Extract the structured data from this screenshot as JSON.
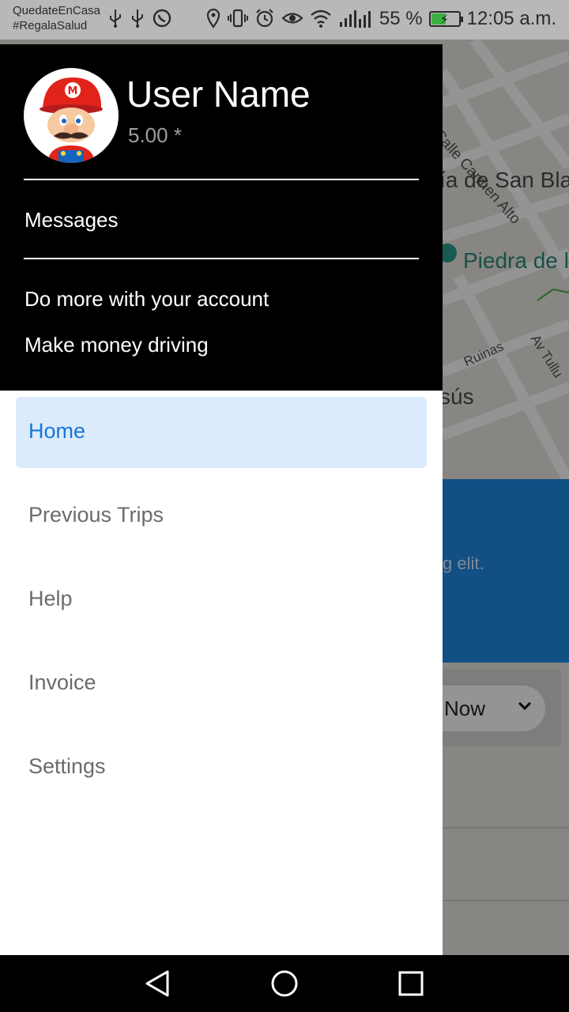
{
  "status_bar": {
    "carrier_line1": "QuedateEnCasa",
    "carrier_line2": "#RegalaSalud",
    "battery_percent": "55 %",
    "battery_level": 0.55,
    "time": "12:05 a.m.",
    "icons": [
      "usb-icon",
      "usb-icon",
      "whatsapp-icon",
      "location-icon",
      "vibrate-icon",
      "alarm-icon",
      "eye-icon",
      "wifi-icon",
      "signal-icon",
      "signal-icon",
      "battery-icon"
    ]
  },
  "map": {
    "labels": {
      "carmen": "Calle Carmen Alto",
      "sanblas": "ía de San Blas",
      "piedra": "Piedra de lo",
      "ruinas": "Ruinas",
      "avtull": "Av Tullu",
      "jesus": "sús"
    },
    "card_text": "g elit.",
    "time_select": "Now"
  },
  "drawer": {
    "user_name": "User Name",
    "rating": "5.00 *",
    "messages": "Messages",
    "do_more": "Do more with your account",
    "make_money": "Make money driving",
    "menu": [
      {
        "label": "Home",
        "active": true
      },
      {
        "label": "Previous Trips",
        "active": false
      },
      {
        "label": "Help",
        "active": false
      },
      {
        "label": "Invoice",
        "active": false
      },
      {
        "label": "Settings",
        "active": false
      }
    ]
  },
  "colors": {
    "header_bg": "#000000",
    "active_bg": "#dcebfc",
    "active_text": "#1677d6",
    "card_blue": "#1e88e5"
  }
}
